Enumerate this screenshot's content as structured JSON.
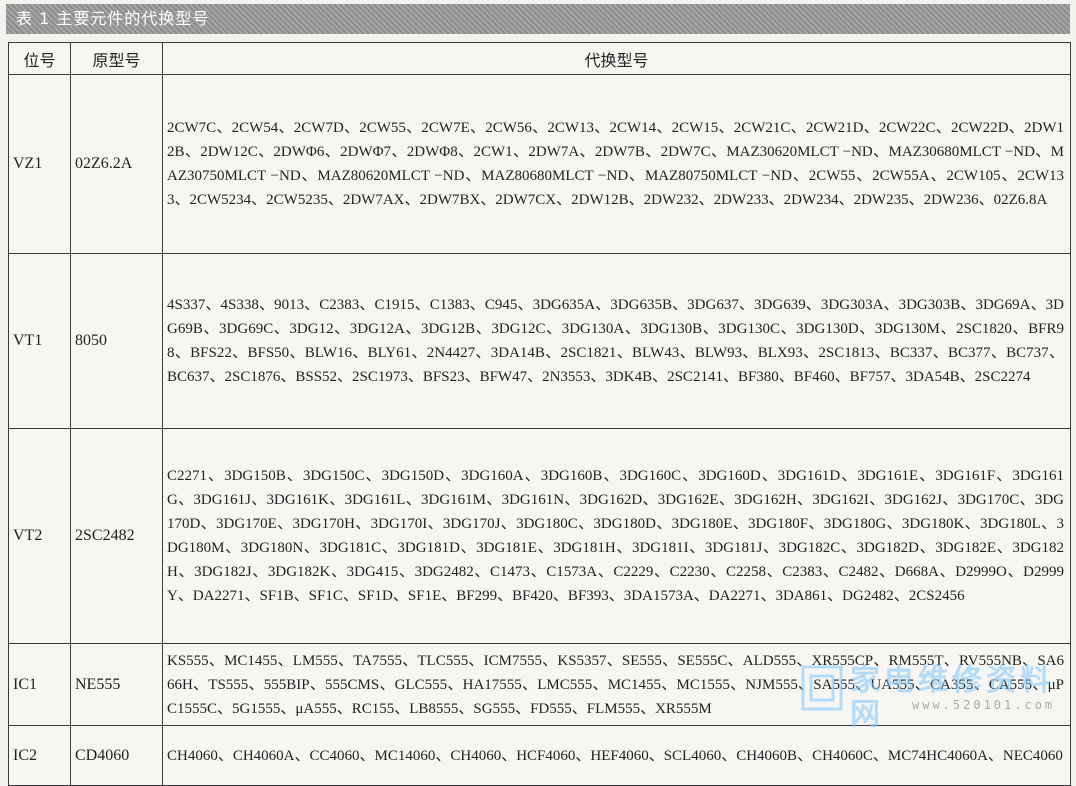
{
  "title": "表 1 主要元件的代换型号",
  "headers": [
    "位号",
    "原型号",
    "代换型号"
  ],
  "rows": [
    {
      "pos": "VZ1",
      "model": "02Z6.2A",
      "subs": "2CW7C、2CW54、2CW7D、2CW55、2CW7E、2CW56、2CW13、2CW14、2CW15、2CW21C、2CW21D、2CW22C、2CW22D、2DW12B、2DW12C、2DWΦ6、2DWΦ7、2DWΦ8、2CW1、2DW7A、2DW7B、2DW7C、MAZ30620MLCT −ND、MAZ30680MLCT −ND、MAZ30750MLCT −ND、MAZ80620MLCT −ND、MAZ80680MLCT −ND、MAZ80750MLCT −ND、2CW55、2CW55A、2CW105、2CW133、2CW5234、2CW5235、2DW7AX、2DW7BX、2DW7CX、2DW12B、2DW232、2DW233、2DW234、2DW235、2DW236、02Z6.8A"
    },
    {
      "pos": "VT1",
      "model": "8050",
      "subs": "4S337、4S338、9013、C2383、C1915、C1383、C945、3DG635A、3DG635B、3DG637、3DG639、3DG303A、3DG303B、3DG69A、3DG69B、3DG69C、3DG12、3DG12A、3DG12B、3DG12C、3DG130A、3DG130B、3DG130C、3DG130D、3DG130M、2SC1820、BFR98、BFS22、BFS50、BLW16、BLY61、2N4427、3DA14B、2SC1821、BLW43、BLW93、BLX93、2SC1813、BC337、BC377、BC737、BC637、2SC1876、BSS52、2SC1973、BFS23、BFW47、2N3553、3DK4B、2SC2141、BF380、BF460、BF757、3DA54B、2SC2274"
    },
    {
      "pos": "VT2",
      "model": "2SC2482",
      "subs": "C2271、3DG150B、3DG150C、3DG150D、3DG160A、3DG160B、3DG160C、3DG160D、3DG161D、3DG161E、3DG161F、3DG161G、3DG161J、3DG161K、3DG161L、3DG161M、3DG161N、3DG162D、3DG162E、3DG162H、3DG162I、3DG162J、3DG170C、3DG170D、3DG170E、3DG170H、3DG170I、3DG170J、3DG180C、3DG180D、3DG180E、3DG180F、3DG180G、3DG180K、3DG180L、3DG180M、3DG180N、3DG181C、3DG181D、3DG181E、3DG181H、3DG181I、3DG181J、3DG182C、3DG182D、3DG182E、3DG182H、3DG182J、3DG182K、3DG415、3DG2482、C1473、C1573A、C2229、C2230、C2258、C2383、C2482、D668A、D2999O、D2999Y、DA2271、SF1B、SF1C、SF1D、SF1E、BF299、BF420、BF393、3DA1573A、DA2271、3DA861、DG2482、2CS2456"
    },
    {
      "pos": "IC1",
      "model": "NE555",
      "subs": "KS555、MC1455、LM555、TA7555、TLC555、ICM7555、KS5357、SE555、SE555C、ALD555、XR555CP、RM555T、RV555NB、SA666H、TS555、555BIP、555CMS、GLC555、HA17555、LMC555、MC1455、MC1555、NJM555、SA555、UA555、CA355、CA555、μPC1555C、5G1555、μA555、RC155、LB8555、SG555、FD555、FLM555、XR555M"
    },
    {
      "pos": "IC2",
      "model": "CD4060",
      "subs": "CH4060、CH4060A、CC4060、MC14060、CH4060、HCF4060、HEF4060、SCL4060、CH4060B、CH4060C、MC74HC4060A、NEC4060"
    }
  ],
  "watermark": {
    "text": "家电维修资料网",
    "url": "www.520101.com"
  },
  "colors": {
    "title_bar": "#999999",
    "border": "#3a3a3a",
    "watermark": "#7fc7ff"
  }
}
